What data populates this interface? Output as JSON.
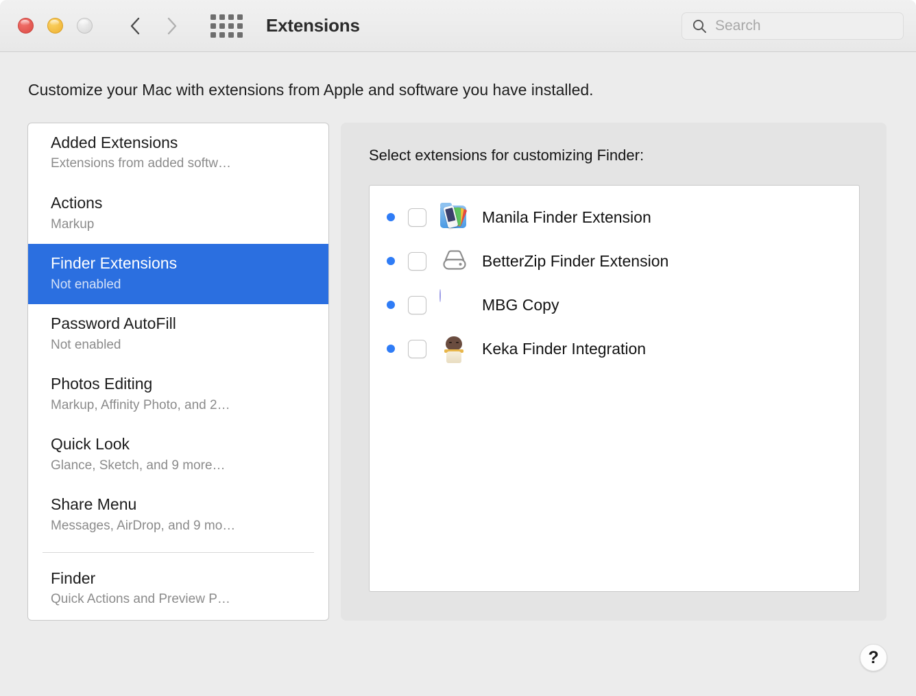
{
  "window": {
    "title": "Extensions",
    "description": "Customize your Mac with extensions from Apple and software you have installed.",
    "accent_color": "#2b6fe0",
    "dot_color": "#2f7cf6"
  },
  "toolbar": {
    "back_icon": "chevron-left-icon",
    "forward_icon": "chevron-right-icon",
    "showall_icon": "grid-icon",
    "close_label": "Close",
    "minimize_label": "Minimize",
    "zoom_label": "Zoom"
  },
  "search": {
    "placeholder": "Search",
    "value": "",
    "icon": "search-icon"
  },
  "sidebar": {
    "items": [
      {
        "title": "Added Extensions",
        "subtitle": "Extensions from added softw…",
        "selected": false
      },
      {
        "title": "Actions",
        "subtitle": "Markup",
        "selected": false
      },
      {
        "title": "Finder Extensions",
        "subtitle": "Not enabled",
        "selected": true
      },
      {
        "title": "Password AutoFill",
        "subtitle": "Not enabled",
        "selected": false
      },
      {
        "title": "Photos Editing",
        "subtitle": "Markup, Affinity Photo, and 2…",
        "selected": false
      },
      {
        "title": "Quick Look",
        "subtitle": "Glance, Sketch, and 9 more…",
        "selected": false
      },
      {
        "title": "Share Menu",
        "subtitle": "Messages, AirDrop, and 9 mo…",
        "selected": false
      }
    ],
    "after_separator": [
      {
        "title": "Finder",
        "subtitle": "Quick Actions and Preview P…",
        "selected": false
      }
    ]
  },
  "detail": {
    "heading": "Select extensions for customizing Finder:",
    "extensions": [
      {
        "label": "Manila Finder Extension",
        "icon": "manila-app-icon",
        "checked": false,
        "has_dot": true
      },
      {
        "label": "BetterZip Finder Extension",
        "icon": "betterzip-app-icon",
        "checked": false,
        "has_dot": true
      },
      {
        "label": "MBG Copy",
        "icon": "mbgcopy-app-icon",
        "checked": false,
        "has_dot": true
      },
      {
        "label": "Keka Finder Integration",
        "icon": "keka-app-icon",
        "checked": false,
        "has_dot": true
      }
    ]
  },
  "help": {
    "label": "?",
    "icon": "help-icon"
  }
}
